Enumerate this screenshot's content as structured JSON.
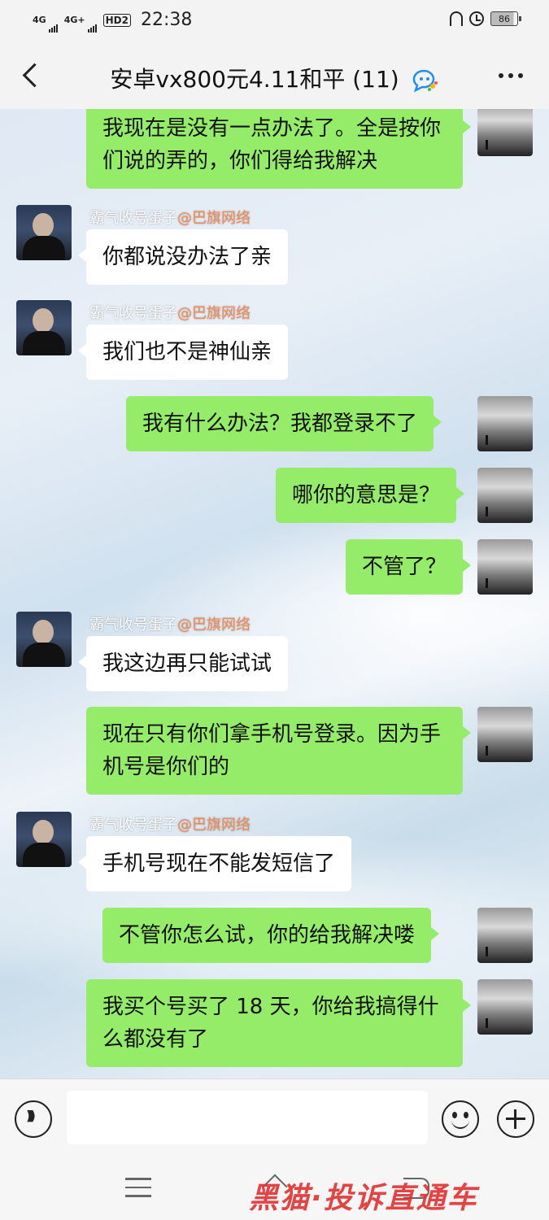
{
  "status_bar": {
    "signal1": "4G",
    "signal2": "4G+",
    "hd": "HD2",
    "time": "22:38",
    "battery": "86"
  },
  "header": {
    "back_icon": "chevron-left-icon",
    "title": "安卓vx800元4.11和平 (11)",
    "title_icon": "enterprise-chat-icon",
    "more_icon": "more-dots-icon"
  },
  "messages": [
    {
      "side": "out",
      "text": "我现在是没有一点办法了。全是按你们说的弄的，你们得给我解决"
    },
    {
      "side": "in",
      "sender": "霸气收号蛋子",
      "tag": "@巴旗网络",
      "text": "你都说没办法了亲"
    },
    {
      "side": "in",
      "sender": "霸气收号蛋子",
      "tag": "@巴旗网络",
      "text": "我们也不是神仙亲"
    },
    {
      "side": "out",
      "text": "我有什么办法？我都登录不了"
    },
    {
      "side": "out",
      "text": "哪你的意思是？"
    },
    {
      "side": "out",
      "text": "不管了？"
    },
    {
      "side": "in",
      "sender": "霸气收号蛋子",
      "tag": "@巴旗网络",
      "text": "我这边再只能试试"
    },
    {
      "side": "out",
      "text": "现在只有你们拿手机号登录。因为手机号是你们的"
    },
    {
      "side": "in",
      "sender": "霸气收号蛋子",
      "tag": "@巴旗网络",
      "text": "手机号现在不能发短信了"
    },
    {
      "side": "out",
      "text": "不管你怎么试，你的给我解决喽"
    },
    {
      "side": "out",
      "text": "我买个号买了 18 天，你给我搞得什么都没有了"
    }
  ],
  "input_bar": {
    "voice_icon": "voice-icon",
    "emoji_icon": "emoji-icon",
    "plus_icon": "plus-icon",
    "input_value": ""
  },
  "watermark": "黑猫·投诉直通车",
  "colors": {
    "out_bubble": "#95ec69",
    "in_bubble": "#ffffff",
    "sender_tag": "#f28a52"
  }
}
